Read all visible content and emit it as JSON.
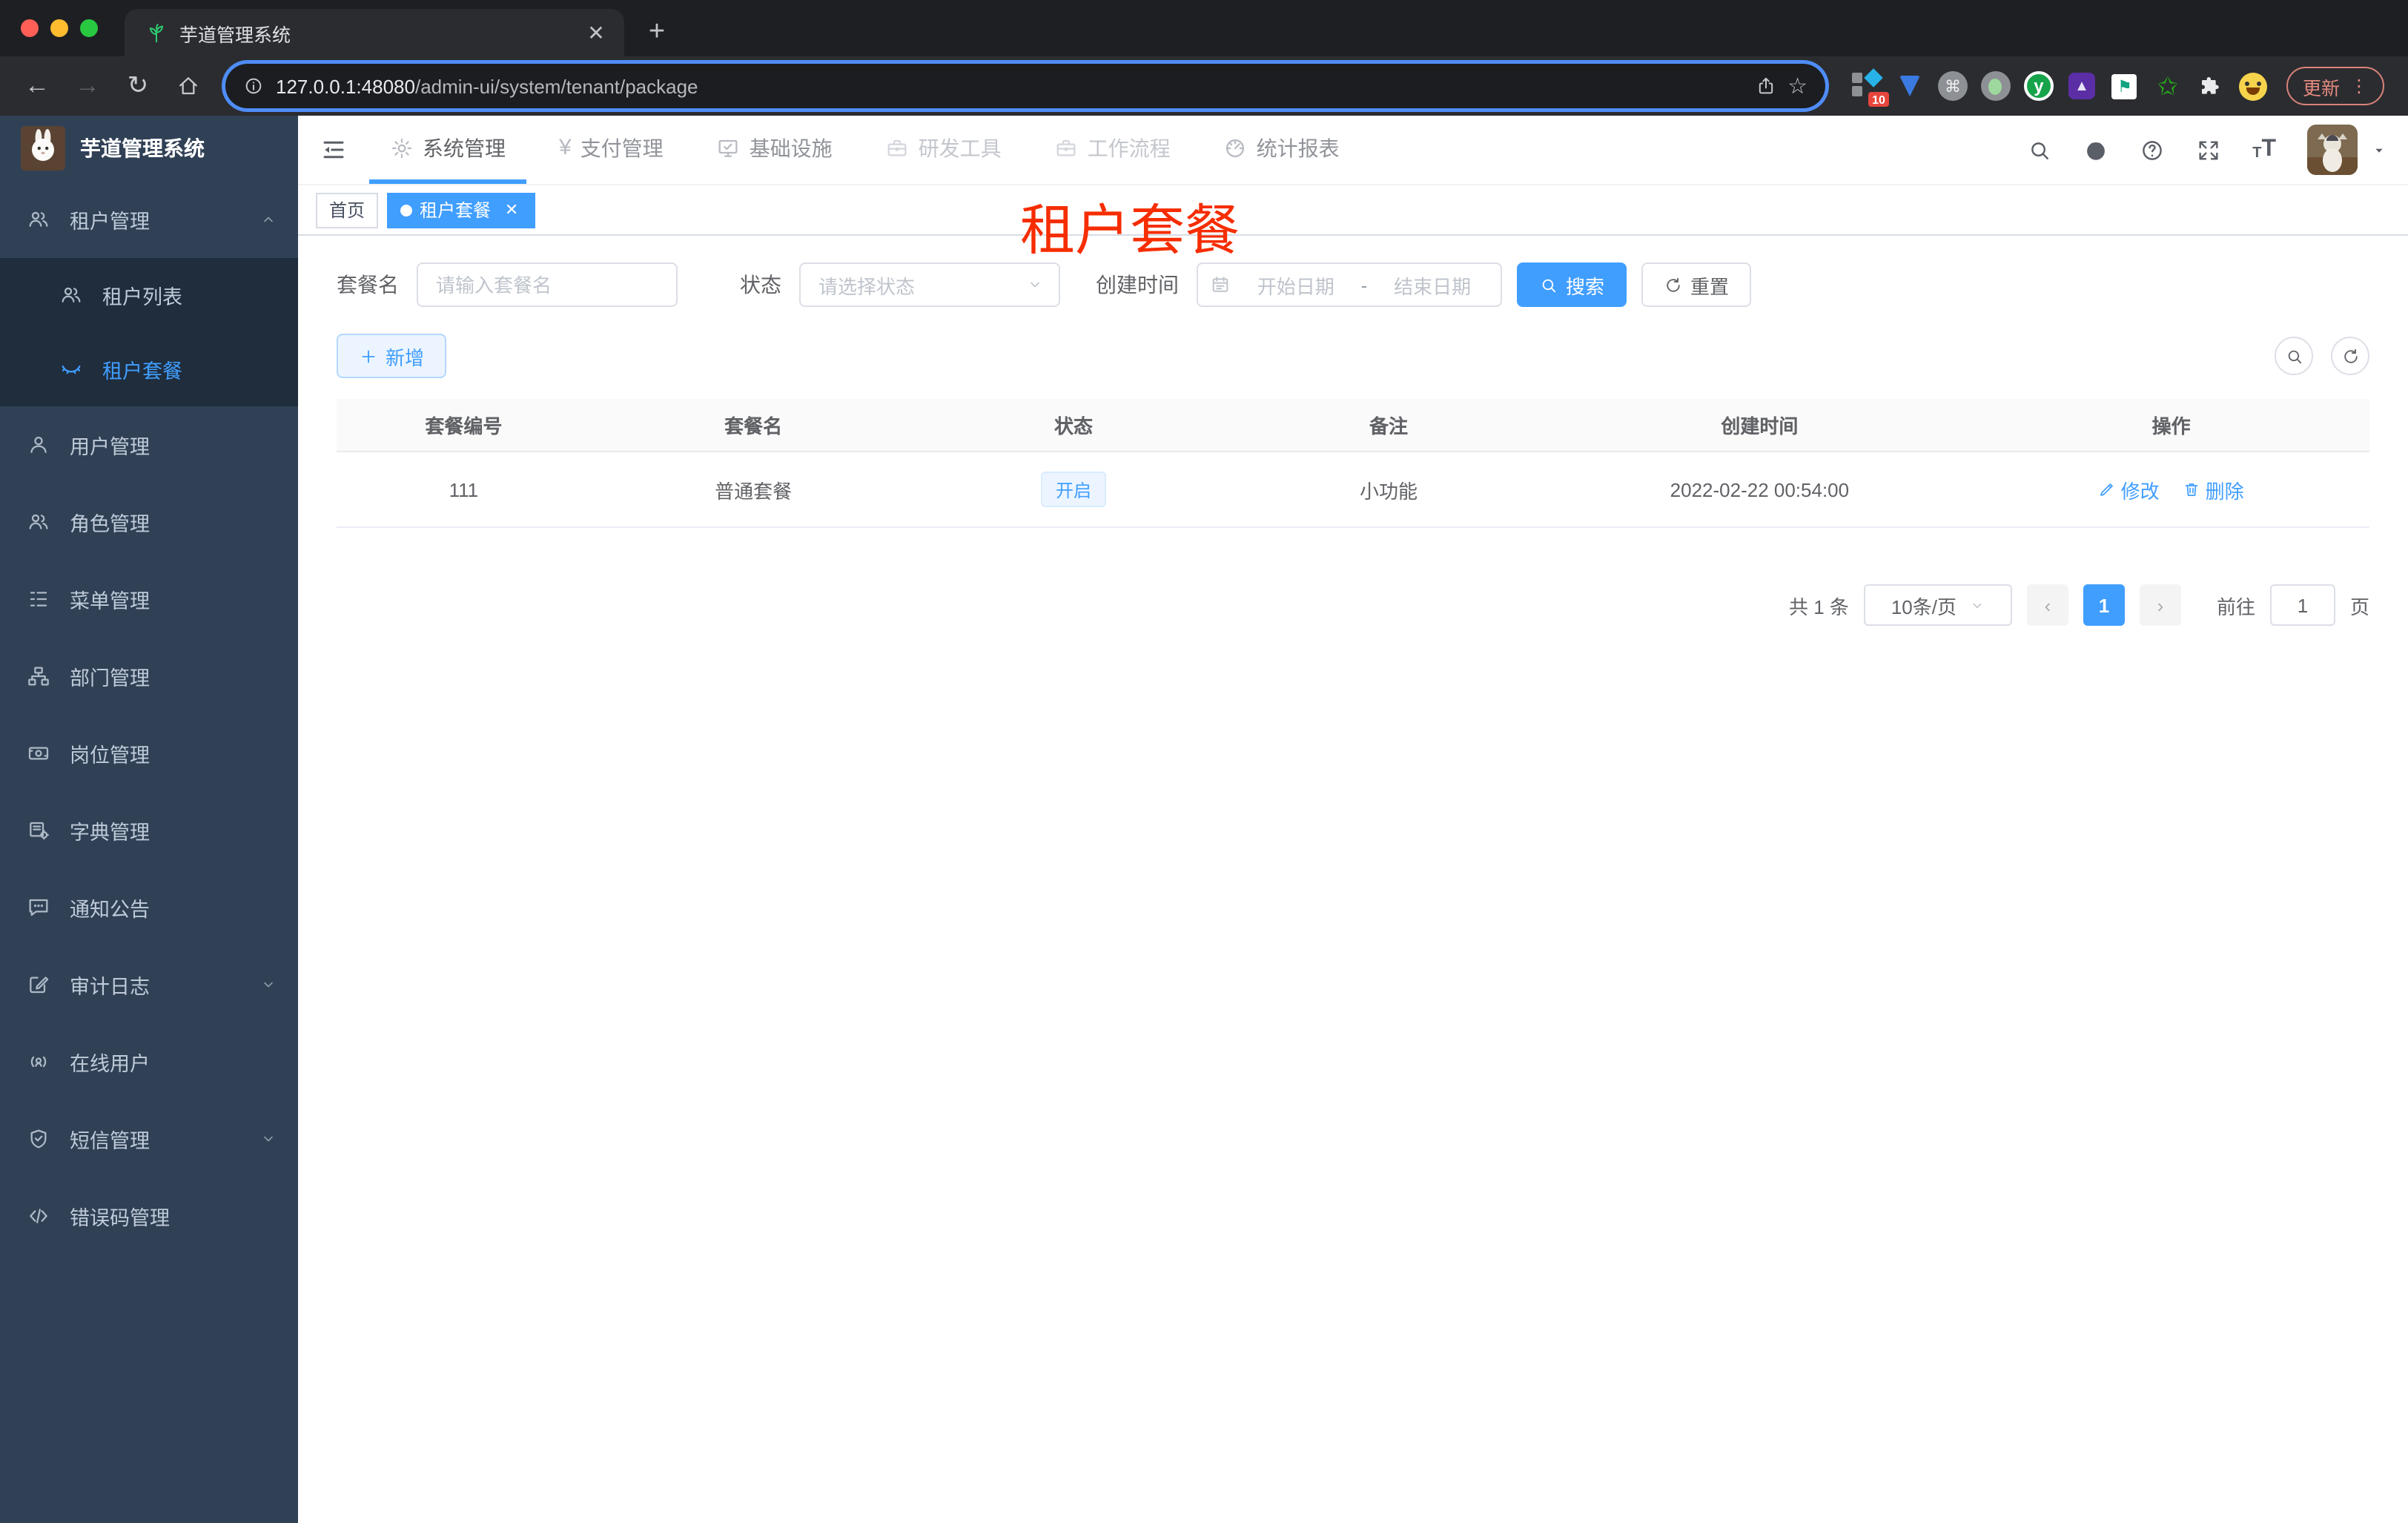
{
  "browser": {
    "tab": {
      "title": "芋道管理系统"
    },
    "url_host": "127.0.0.1:48080",
    "url_path": "/admin-ui/system/tenant/package",
    "extension_badge": "10",
    "update_button": "更新"
  },
  "header": {
    "nav": [
      {
        "label": "系统管理"
      },
      {
        "label": "支付管理"
      },
      {
        "label": "基础设施"
      },
      {
        "label": "研发工具"
      },
      {
        "label": "工作流程"
      },
      {
        "label": "统计报表"
      }
    ]
  },
  "sidebar": {
    "title": "芋道管理系统",
    "items": [
      {
        "label": "租户管理",
        "children": [
          {
            "label": "租户列表"
          },
          {
            "label": "租户套餐"
          }
        ]
      },
      {
        "label": "用户管理"
      },
      {
        "label": "角色管理"
      },
      {
        "label": "菜单管理"
      },
      {
        "label": "部门管理"
      },
      {
        "label": "岗位管理"
      },
      {
        "label": "字典管理"
      },
      {
        "label": "通知公告"
      },
      {
        "label": "审计日志"
      },
      {
        "label": "在线用户"
      },
      {
        "label": "短信管理"
      },
      {
        "label": "错误码管理"
      }
    ]
  },
  "tags": {
    "home": "首页",
    "active": "租户套餐"
  },
  "overlay_title": "租户套餐",
  "filters": {
    "name_label": "套餐名",
    "name_placeholder": "请输入套餐名",
    "status_label": "状态",
    "status_placeholder": "请选择状态",
    "time_label": "创建时间",
    "start_placeholder": "开始日期",
    "separator": "-",
    "end_placeholder": "结束日期",
    "search": "搜索",
    "reset": "重置"
  },
  "toolbar": {
    "add": "新增"
  },
  "table": {
    "headers": [
      "套餐编号",
      "套餐名",
      "状态",
      "备注",
      "创建时间",
      "操作"
    ],
    "row": {
      "id": "111",
      "name": "普通套餐",
      "status": "开启",
      "remark": "小功能",
      "created": "2022-02-22 00:54:00",
      "edit": "修改",
      "delete": "删除"
    }
  },
  "pagination": {
    "total": "共 1 条",
    "page_size": "10条/页",
    "page": "1",
    "goto": "前往",
    "goto_value": "1",
    "unit": "页"
  },
  "colors": {
    "primary": "#409eff",
    "annotation_red": "#f62d01",
    "sidebar_bg": "#304156",
    "submenu_bg": "#1f2d3d",
    "tag_blue_bg": "#ecf5ff"
  }
}
